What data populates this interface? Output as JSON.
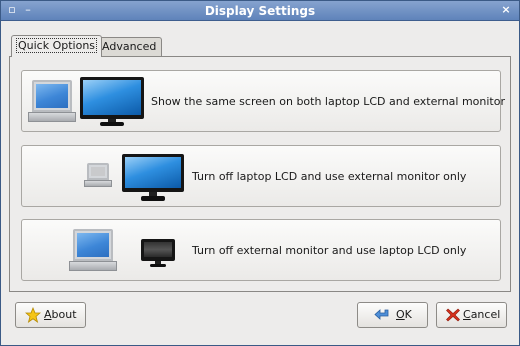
{
  "window": {
    "title": "Display Settings",
    "menu_glyph": "▫",
    "minimize_glyph": "–",
    "close_glyph": "×"
  },
  "tabs": [
    {
      "label": "Quick Options",
      "active": true
    },
    {
      "label": "Advanced",
      "active": false
    }
  ],
  "options": [
    {
      "label": "Show the same screen on both laptop LCD and external monitor",
      "laptop_on": true,
      "monitor_on": true
    },
    {
      "label": "Turn off laptop LCD and use external monitor only",
      "laptop_on": false,
      "monitor_on": true
    },
    {
      "label": "Turn off external monitor and use laptop LCD only",
      "laptop_on": true,
      "monitor_on": false
    }
  ],
  "buttons": {
    "about": {
      "mnemonic": "A",
      "rest": "bout",
      "icon": "star-icon"
    },
    "ok": {
      "mnemonic": "O",
      "rest": "K",
      "icon": "ok-arrow-icon"
    },
    "cancel": {
      "mnemonic": "C",
      "rest": "ancel",
      "icon": "cancel-x-icon"
    }
  },
  "colors": {
    "titlebar": "#6f90c4",
    "accent_blue": "#2e8fe0",
    "cancel_red": "#d6301c",
    "star_yellow": "#f5c518"
  }
}
